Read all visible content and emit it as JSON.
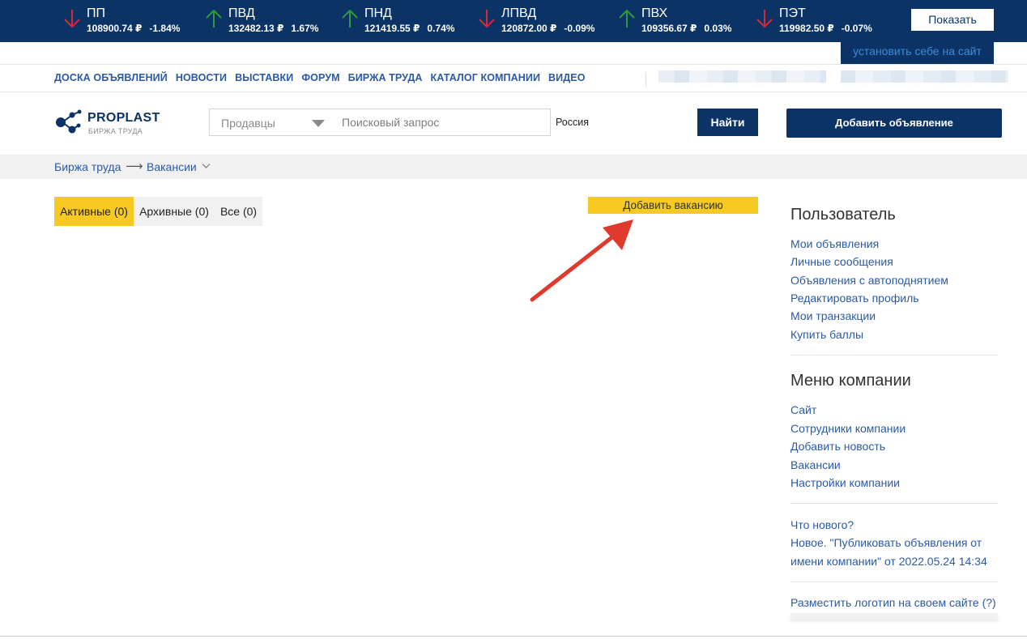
{
  "ticker": {
    "items": [
      {
        "name": "ПП",
        "price": "108900.74 ₽",
        "change": "-1.84%",
        "direction": "down"
      },
      {
        "name": "ПВД",
        "price": "132482.13 ₽",
        "change": "1.67%",
        "direction": "up"
      },
      {
        "name": "ПНД",
        "price": "121419.55 ₽",
        "change": "0.74%",
        "direction": "up"
      },
      {
        "name": "ЛПВД",
        "price": "120872.00 ₽",
        "change": "-0.09%",
        "direction": "down"
      },
      {
        "name": "ПВХ",
        "price": "109356.67 ₽",
        "change": "0.03%",
        "direction": "up"
      },
      {
        "name": "ПЭТ",
        "price": "119982.50 ₽",
        "change": "-0.07%",
        "direction": "down"
      }
    ],
    "show_label": "Показать",
    "install_label": "установить себе на сайт",
    "colors": {
      "up": "#2e9a3e",
      "down": "#d8263a",
      "bar": "#0b3366"
    }
  },
  "nav": {
    "items": [
      "ДОСКА ОБЪЯВЛЕНИЙ",
      "НОВОСТИ",
      "ВЫСТАВКИ",
      "ФОРУМ",
      "БИРЖА ТРУДА",
      "КАТАЛОГ КОМПАНИИ",
      "ВИДЕО"
    ]
  },
  "logo": {
    "brand": "PROPLAST",
    "sub": "БИРЖА ТРУДА"
  },
  "search": {
    "select_value": "Продавцы",
    "query_placeholder": "Поисковый запрос",
    "region_value": "Россия",
    "find_label": "Найти"
  },
  "add_ad_label": "Добавить объявление",
  "breadcrumb": {
    "first": "Биржа труда",
    "arrow": "⟶",
    "second": "Вакансии"
  },
  "tabs": {
    "active": "Активные (0)",
    "archived": "Архивные (0)",
    "all": "Все (0)"
  },
  "add_vacancy_label": "Добавить вакансию",
  "sidebar": {
    "user_title": "Пользователь",
    "user_links": [
      "Мои объявления",
      "Личные сообщения",
      "Объявления с автоподнятием",
      "Редактировать профиль",
      "Мои транзакции",
      "Купить баллы"
    ],
    "company_title": "Меню компании",
    "company_links": [
      "Сайт",
      "Сотрудники компании",
      "Добавить новость",
      "Вакансии",
      "Настройки компании"
    ],
    "whats_new": "Что нового?",
    "news_line1": "Новое. \"Публиковать объявления от",
    "news_line2": "имени компании\" от 2022.05.24 14:34",
    "logo_link": "Разместить логотип на своем сайте (?)"
  }
}
